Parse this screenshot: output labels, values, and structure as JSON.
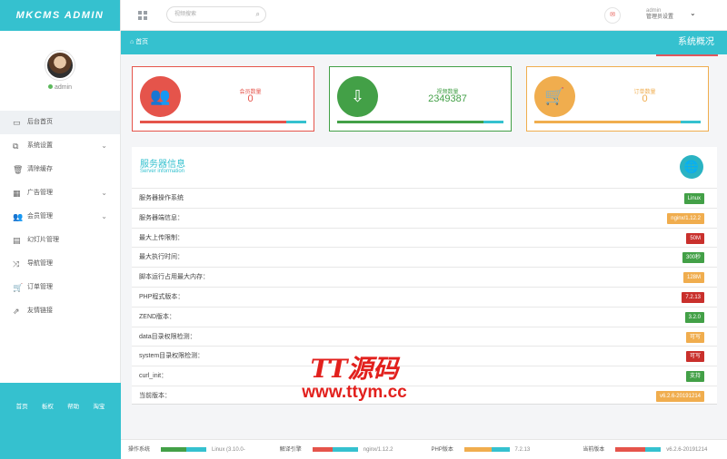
{
  "brand": "MKCMS ADMIN",
  "user": {
    "name": "admin"
  },
  "sidebar": {
    "items": [
      {
        "label": "后台首页",
        "icon": "laptop-icon",
        "glyph": "▭",
        "chev": false,
        "active": true
      },
      {
        "label": "系统设置",
        "icon": "settings-icon",
        "glyph": "⧉",
        "chev": true,
        "active": false
      },
      {
        "label": "清除缓存",
        "icon": "trash-icon",
        "glyph": "🗑",
        "chev": false,
        "active": false
      },
      {
        "label": "广告管理",
        "icon": "image-icon",
        "glyph": "▦",
        "chev": true,
        "active": false
      },
      {
        "label": "会员管理",
        "icon": "users-icon",
        "glyph": "👥",
        "chev": true,
        "active": false
      },
      {
        "label": "幻灯片管理",
        "icon": "table-icon",
        "glyph": "▤",
        "chev": false,
        "active": false
      },
      {
        "label": "导航管理",
        "icon": "shuffle-icon",
        "glyph": "⤨",
        "chev": false,
        "active": false
      },
      {
        "label": "订单管理",
        "icon": "cart-icon",
        "glyph": "🛒",
        "chev": false,
        "active": false
      },
      {
        "label": "友情链接",
        "icon": "external-link-icon",
        "glyph": "⇗",
        "chev": false,
        "active": false
      }
    ],
    "footer_links": [
      "首页",
      "板权",
      "帮助",
      "淘宝"
    ]
  },
  "topbar": {
    "search_placeholder": "视频搜索",
    "admin_name": "admin",
    "admin_role": "管理员设置"
  },
  "breadcrumb": {
    "home": "首页",
    "title": "系统概况"
  },
  "cards": [
    {
      "label": "会员数量",
      "value": "0",
      "color": "#e5544b",
      "icon": "users-icon",
      "glyph": "👥",
      "bar_fraction": 0.88
    },
    {
      "label": "视频数量",
      "value": "2349387",
      "color": "#43a047",
      "icon": "download-icon",
      "glyph": "⇩",
      "bar_fraction": 0.88
    },
    {
      "label": "订单数量",
      "value": "0",
      "color": "#f0ad4e",
      "icon": "cart-icon",
      "glyph": "🛒",
      "bar_fraction": 0.88
    }
  ],
  "server": {
    "title": "服务器信息",
    "subtitle": "Server information",
    "rows": [
      {
        "label": "服务器操作系统",
        "value": "Linux",
        "color": "#43a047"
      },
      {
        "label": "服务器端信息：",
        "value": "nginx/1.12.2",
        "color": "#f0ad4e"
      },
      {
        "label": "最大上传限制：",
        "value": "50M",
        "color": "#c9302c"
      },
      {
        "label": "最大执行时间：",
        "value": "300秒",
        "color": "#43a047"
      },
      {
        "label": "脚本运行占用最大内存：",
        "value": "128M",
        "color": "#f0ad4e"
      },
      {
        "label": "PHP程式版本：",
        "value": "7.2.13",
        "color": "#c9302c"
      },
      {
        "label": "ZEND版本：",
        "value": "3.2.0",
        "color": "#43a047"
      },
      {
        "label": "data目录权限检测：",
        "value": "可写",
        "color": "#f0ad4e"
      },
      {
        "label": "system目录权限检测：",
        "value": "可写",
        "color": "#c9302c"
      },
      {
        "label": "curl_init：",
        "value": "支持",
        "color": "#43a047"
      },
      {
        "label": "当前版本：",
        "value": "v6.2.6-20191214",
        "color": "#f0ad4e"
      }
    ]
  },
  "watermark": {
    "line1": "TT源码",
    "line2": "www.ttym.cc"
  },
  "footer": [
    {
      "label": "操作系统",
      "value": "Linux (3.10.0-",
      "color": "#43a047",
      "fraction": 0.55
    },
    {
      "label": "解译引擎",
      "value": "nginx/1.12.2",
      "color": "#e5544b",
      "fraction": 0.45
    },
    {
      "label": "PHP版本",
      "value": "7.2.13",
      "color": "#f0ad4e",
      "fraction": 0.6
    },
    {
      "label": "当前版本",
      "value": "v6.2.6-20191214",
      "color": "#e5544b",
      "fraction": 0.65
    }
  ]
}
